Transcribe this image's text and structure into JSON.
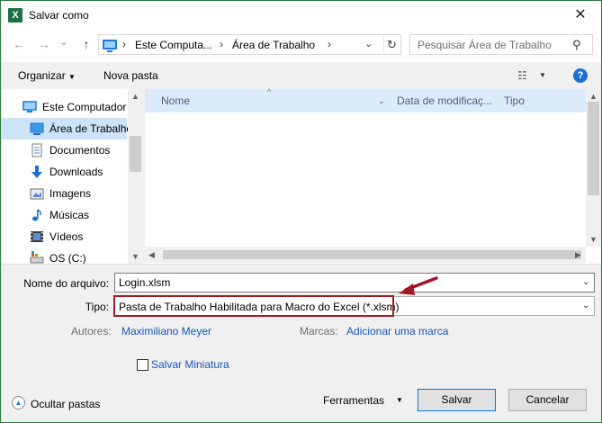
{
  "window": {
    "title": "Salvar como",
    "app_icon": "excel-icon",
    "close_glyph": "✕"
  },
  "nav": {
    "back": "←",
    "forward": "→",
    "recent": "⌄",
    "up": "↑",
    "breadcrumb": [
      "Este Computa...",
      "Área de Trabalho"
    ],
    "search_placeholder": "Pesquisar Área de Trabalho"
  },
  "toolbar": {
    "organize": "Organizar",
    "new_folder": "Nova pasta",
    "help": "?"
  },
  "sidebar": {
    "items": [
      {
        "label": "Este Computador",
        "icon": "computer-icon"
      },
      {
        "label": "Área de Trabalho",
        "icon": "desktop-icon",
        "selected": true
      },
      {
        "label": "Documentos",
        "icon": "documents-icon"
      },
      {
        "label": "Downloads",
        "icon": "downloads-icon"
      },
      {
        "label": "Imagens",
        "icon": "pictures-icon"
      },
      {
        "label": "Músicas",
        "icon": "music-icon"
      },
      {
        "label": "Vídeos",
        "icon": "videos-icon"
      },
      {
        "label": "OS (C:)",
        "icon": "drive-icon"
      }
    ]
  },
  "file_list": {
    "columns": [
      "Nome",
      "Data de modificaç...",
      "Tipo"
    ]
  },
  "form": {
    "filename_label": "Nome do arquivo:",
    "filename_value": "Login.xlsm",
    "type_label": "Tipo:",
    "type_value": "Pasta de Trabalho Habilitada para Macro do Excel (*.xlsm)",
    "authors_label": "Autores:",
    "authors_value": "Maximiliano Meyer",
    "tags_label": "Marcas:",
    "tags_value": "Adicionar uma marca",
    "thumbnail_label": "Salvar Miniatura"
  },
  "footer": {
    "hide_folders": "Ocultar pastas",
    "tools": "Ferramentas",
    "save": "Salvar",
    "cancel": "Cancelar"
  },
  "colors": {
    "annotation_arrow": "#a11826",
    "selection": "#cce4f7",
    "link": "#1a56b8"
  }
}
